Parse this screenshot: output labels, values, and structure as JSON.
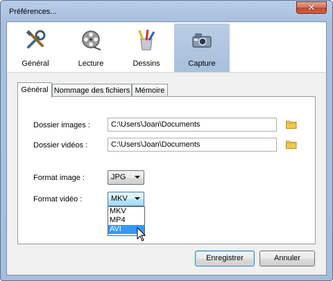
{
  "window": {
    "title": "Préférences..."
  },
  "categories": [
    {
      "label": "Général",
      "icon": "tools-icon"
    },
    {
      "label": "Lecture",
      "icon": "film-reel-icon"
    },
    {
      "label": "Dessins",
      "icon": "drawing-tools-icon"
    },
    {
      "label": "Capture",
      "icon": "camera-icon"
    }
  ],
  "tabs": [
    "Général",
    "Nommage des fichiers",
    "Mémoire"
  ],
  "fields": {
    "images_label": "Dossier images :",
    "images_value": "C:\\Users\\Joan\\Documents",
    "videos_label": "Dossier vidéos :",
    "videos_value": "C:\\Users\\Joan\\Documents",
    "format_image_label": "Format image :",
    "format_image_value": "JPG",
    "format_video_label": "Format vidéo :",
    "format_video_value": "MKV"
  },
  "dropdown": {
    "options": [
      "MKV",
      "MP4",
      "AVI"
    ],
    "highlighted": "AVI"
  },
  "buttons": {
    "save": "Enregistrer",
    "cancel": "Annuler"
  },
  "colors": {
    "selected_category": "#a8c0dd",
    "highlight": "#3399ff"
  }
}
